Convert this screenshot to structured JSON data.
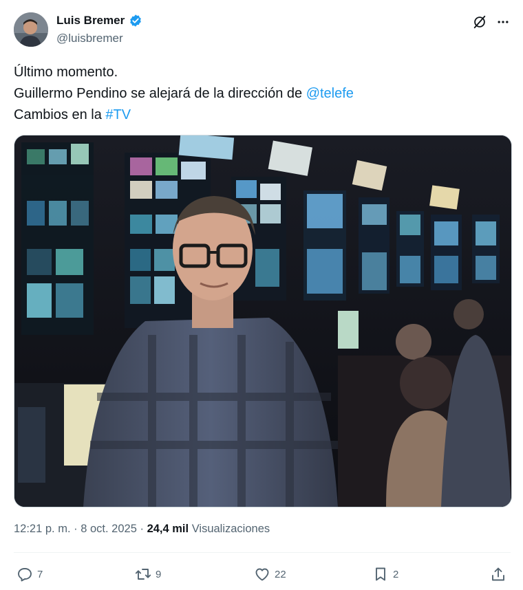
{
  "author": {
    "display_name": "Luis Bremer",
    "handle": "@luisbremer",
    "verified": true
  },
  "icons": {
    "verified": "verified-badge-icon",
    "grok": "grok-icon",
    "more": "more-icon",
    "reply": "reply-icon",
    "retweet": "retweet-icon",
    "like": "like-icon",
    "bookmark": "bookmark-icon",
    "share": "share-icon"
  },
  "tweet": {
    "line1": "Último momento.",
    "line2_prefix": "Guillermo Pendino se alejará de la dirección de ",
    "line2_mention": "@telefe",
    "line3_prefix": "Cambios en la ",
    "line3_hashtag": "#TV"
  },
  "meta": {
    "time": "12:21 p. m.",
    "sep1": " · ",
    "date": "8 oct. 2025",
    "sep2": " · ",
    "views_count": "24,4 mil",
    "views_label": " Visualizaciones"
  },
  "actions": {
    "replies": "7",
    "retweets": "9",
    "likes": "22",
    "bookmarks": "2"
  },
  "colors": {
    "accent": "#1d9bf0",
    "text": "#0f1419",
    "secondary": "#536471"
  }
}
